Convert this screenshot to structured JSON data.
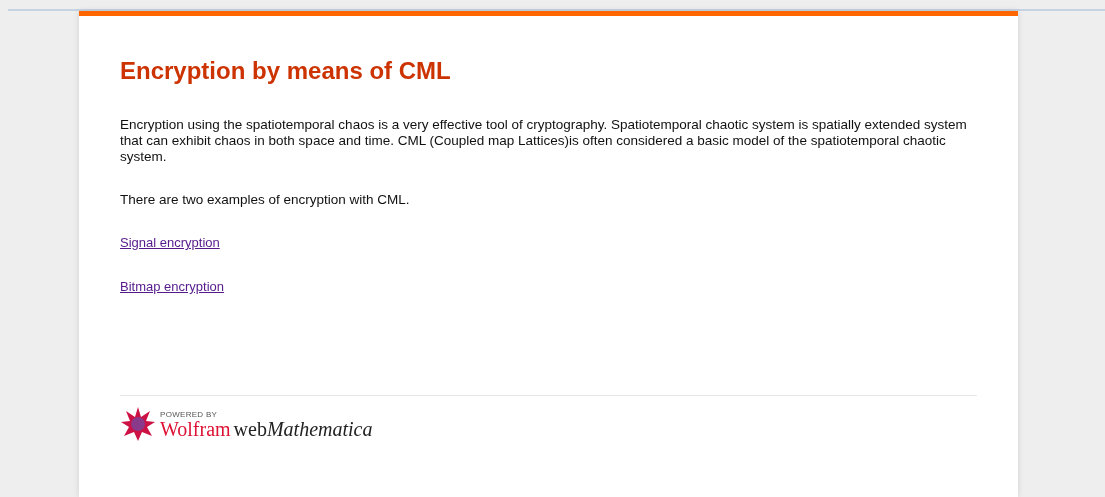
{
  "title": "Encryption by means of CML",
  "paragraphs": [
    "Encryption using the spatiotemporal chaos is a very effective tool of cryptography. Spatiotemporal chaotic system is spatially extended system that can exhibit chaos in both space and time. CML (Coupled map Lattices)is often considered a basic model of the spatiotemporal chaotic system.",
    "There are two examples of encryption with CML."
  ],
  "links": [
    "Signal encryption",
    "Bitmap encryption"
  ],
  "footer": {
    "powered_by": "POWERED BY",
    "brand": "Wolfram",
    "product_prefix": "web",
    "product": "Mathematica"
  }
}
